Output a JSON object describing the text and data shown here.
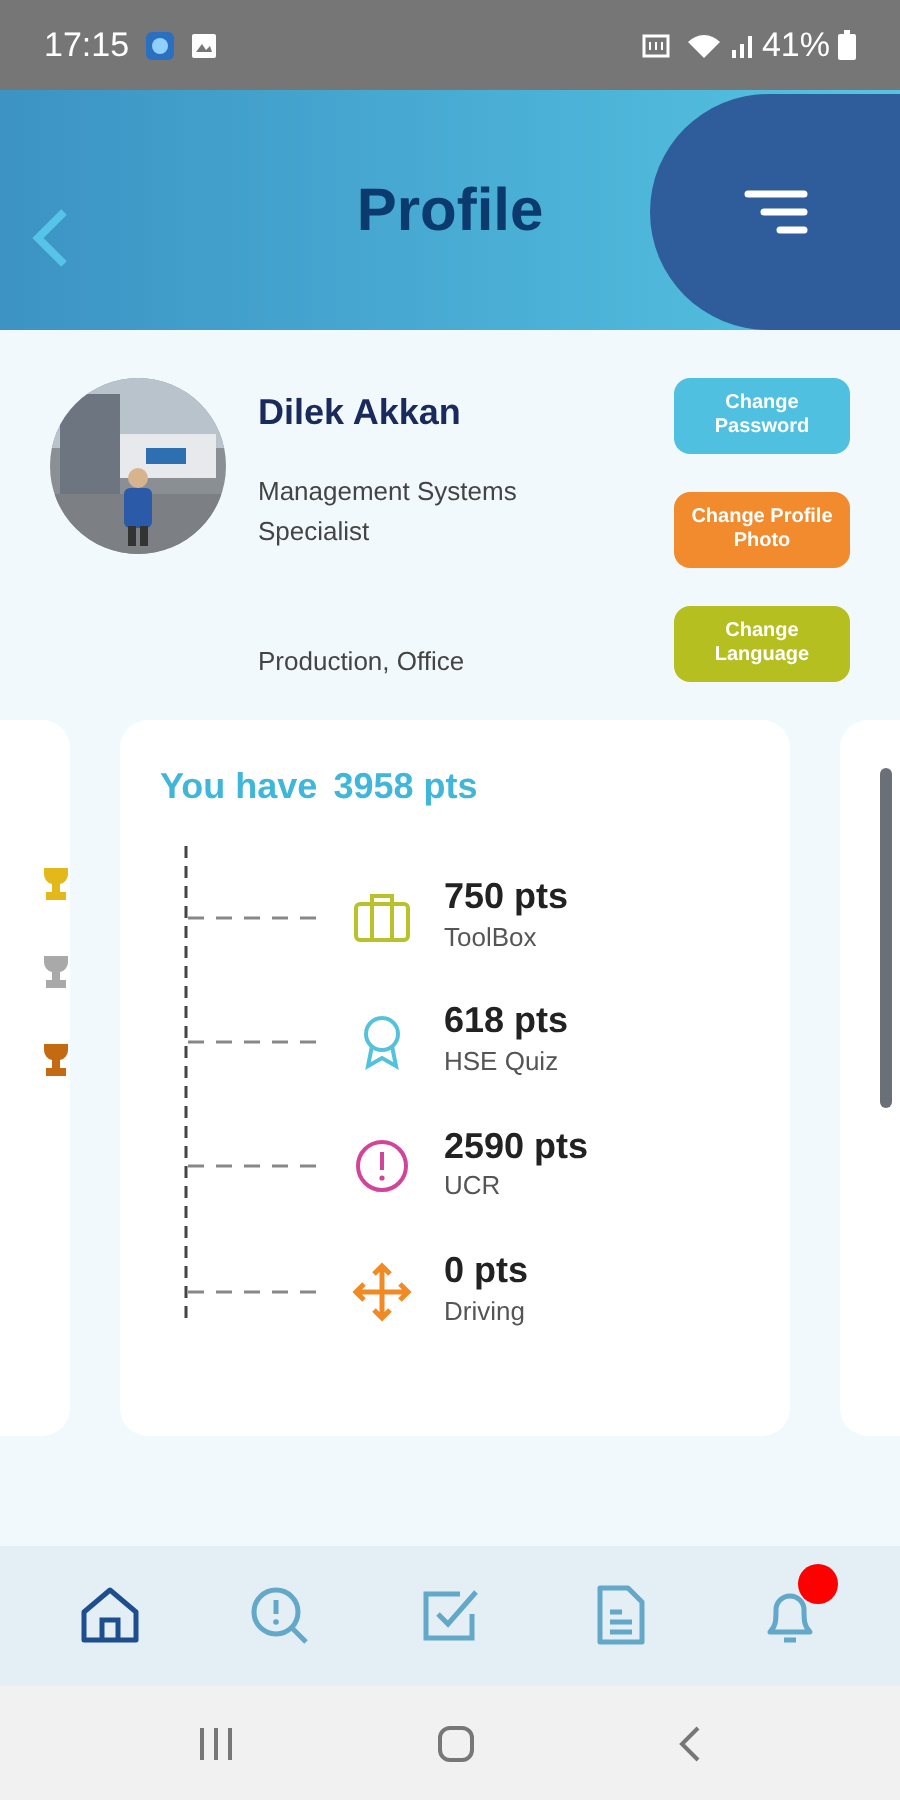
{
  "status_bar": {
    "time": "17:15",
    "battery": "41%"
  },
  "header": {
    "title": "Profile"
  },
  "profile": {
    "name": "Dilek Akkan",
    "job": "Management Systems Specialist",
    "location": "Production, Office",
    "buttons": [
      {
        "label": "Change Password",
        "color": "#4fc0e0"
      },
      {
        "label": "Change Profile Photo",
        "color": "#f28a2e"
      },
      {
        "label": "Change Language",
        "color": "#b5c020"
      }
    ]
  },
  "trophies": [
    {
      "color": "#e3b81b"
    },
    {
      "color": "#a9a9a9"
    },
    {
      "color": "#c46a12"
    }
  ],
  "points": {
    "label": "You have",
    "total": "3958 pts",
    "categories": [
      {
        "kind": "toolbox",
        "points": "750 pts",
        "name": "ToolBox"
      },
      {
        "kind": "award",
        "points": "618 pts",
        "name": "HSE Quiz"
      },
      {
        "kind": "alert",
        "points": "2590 pts",
        "name": "UCR"
      },
      {
        "kind": "move",
        "points": "0 pts",
        "name": "Driving"
      }
    ]
  },
  "bottom_nav": [
    {
      "kind": "home",
      "selected": true,
      "badge": false
    },
    {
      "kind": "search",
      "selected": false,
      "badge": false
    },
    {
      "kind": "check",
      "selected": false,
      "badge": false
    },
    {
      "kind": "document",
      "selected": false,
      "badge": false
    },
    {
      "kind": "bell",
      "selected": false,
      "badge": true
    }
  ]
}
